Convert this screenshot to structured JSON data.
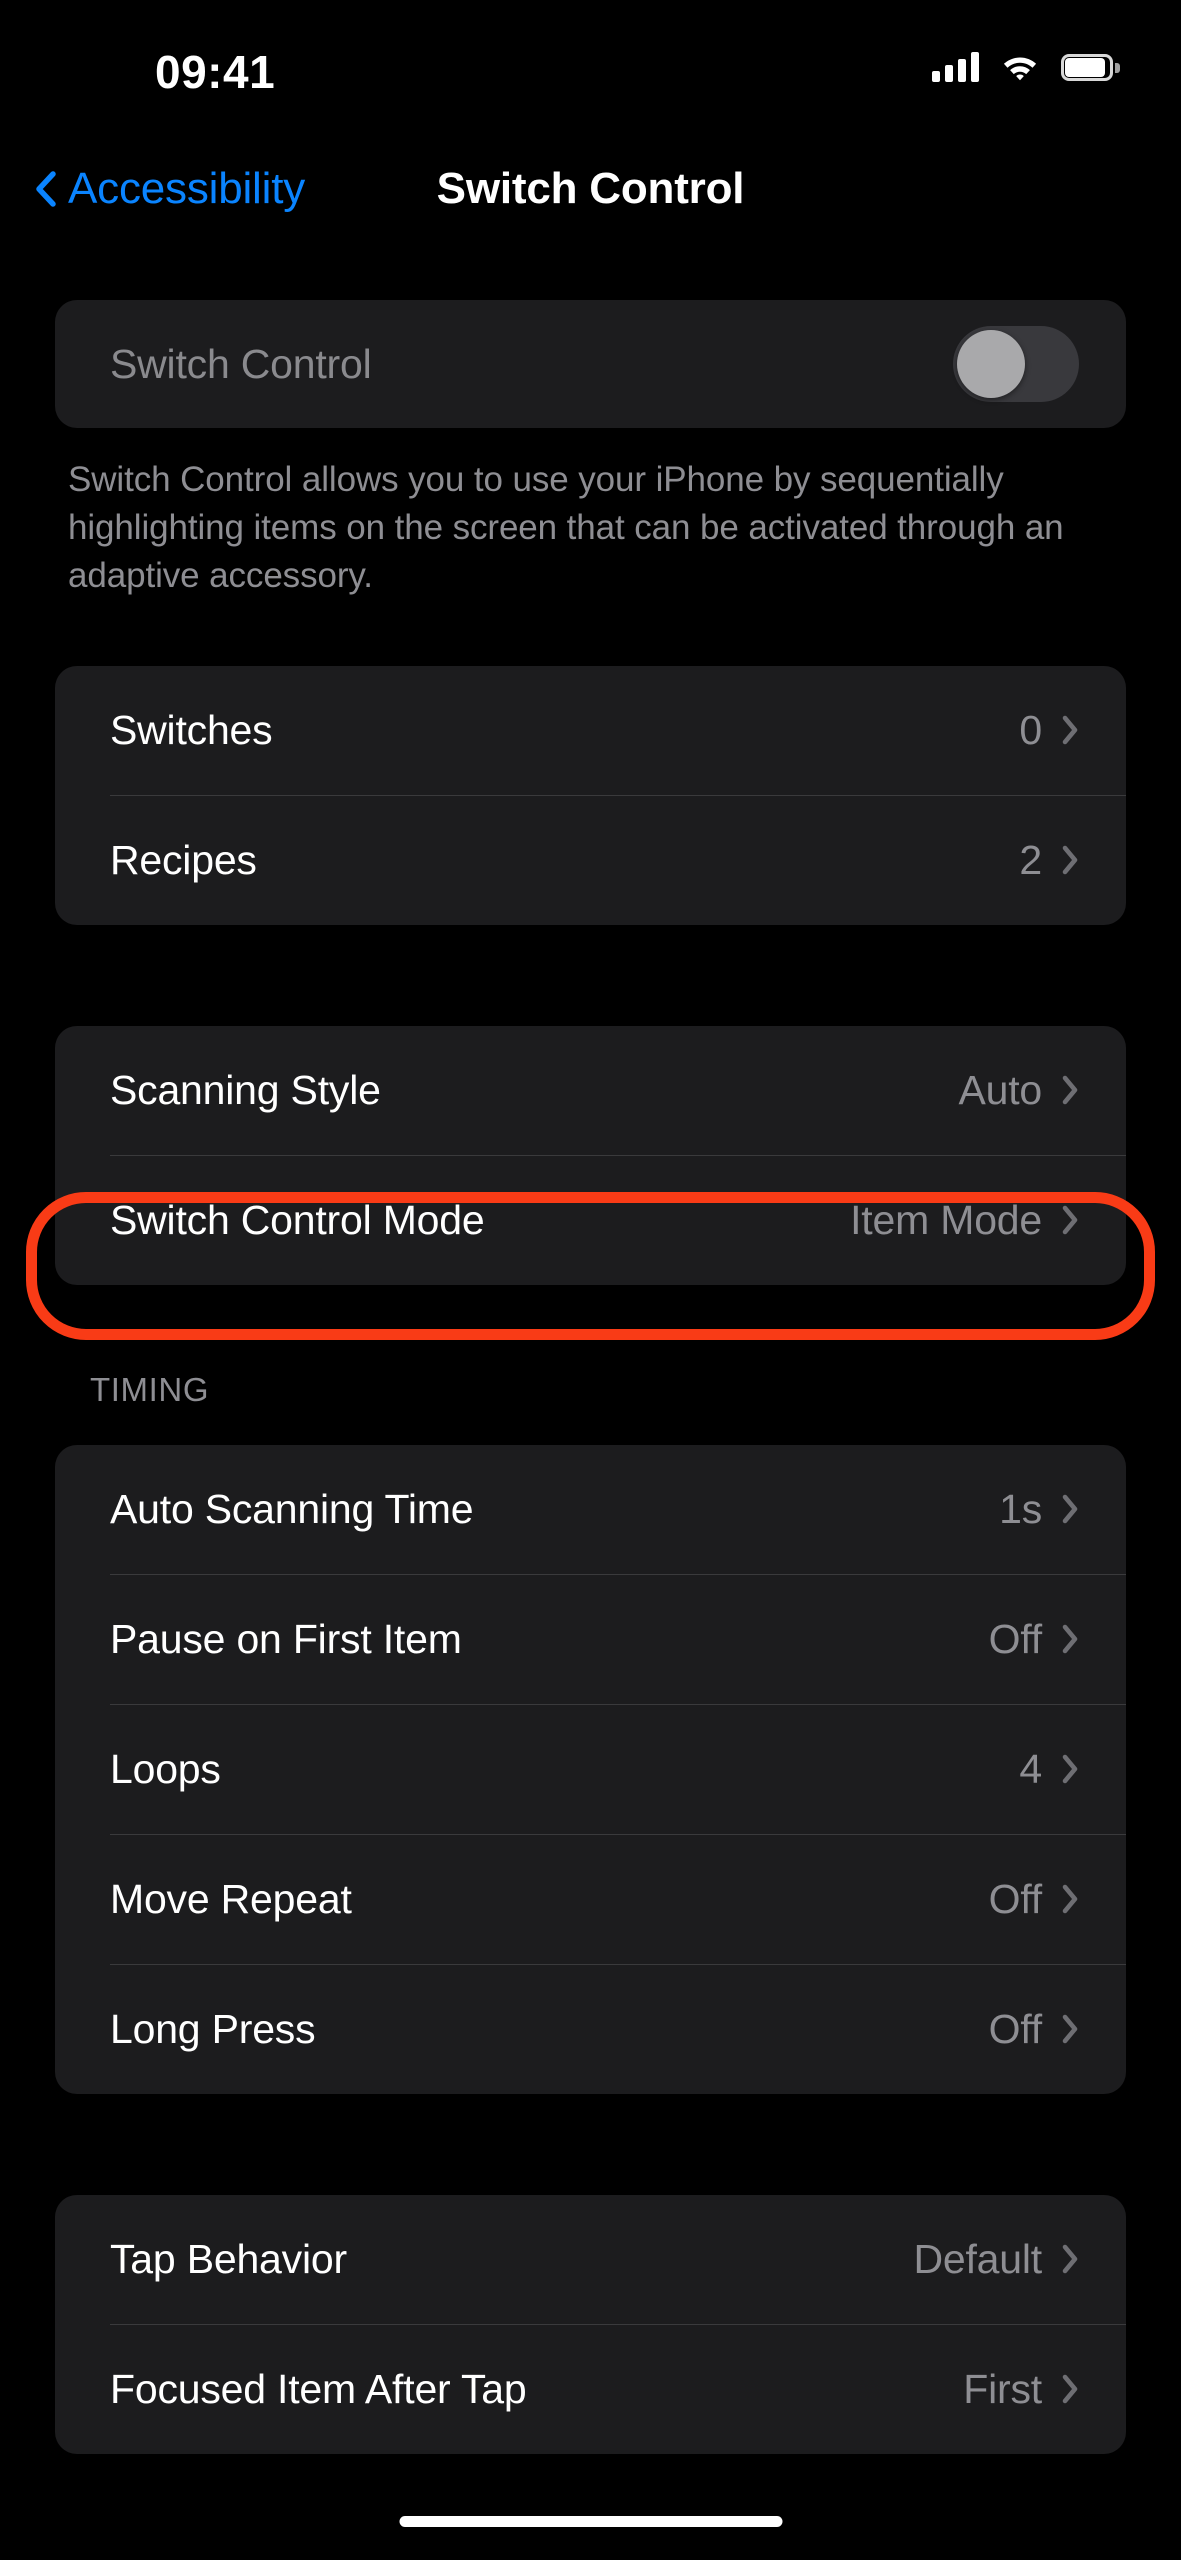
{
  "status_bar": {
    "time": "09:41",
    "cellular_icon": "cellular-signal-icon",
    "wifi_icon": "wifi-icon",
    "battery_icon": "battery-full-icon"
  },
  "nav": {
    "back_icon": "chevron-left-icon",
    "back_label": "Accessibility",
    "title": "Switch Control"
  },
  "toggle_section": {
    "label": "Switch Control",
    "state": "off",
    "footnote": "Switch Control allows you to use your iPhone by sequentially highlighting items on the screen that can be activated through an adaptive accessory."
  },
  "groups": [
    {
      "header": "",
      "rows": [
        {
          "title": "Switches",
          "value": "0",
          "chevron": "chevron-right-icon"
        },
        {
          "title": "Recipes",
          "value": "2",
          "chevron": "chevron-right-icon"
        }
      ]
    },
    {
      "header": "",
      "rows": [
        {
          "title": "Scanning Style",
          "value": "Auto",
          "chevron": "chevron-right-icon"
        },
        {
          "title": "Switch Control Mode",
          "value": "Item Mode",
          "chevron": "chevron-right-icon"
        }
      ]
    },
    {
      "header": "TIMING",
      "rows": [
        {
          "title": "Auto Scanning Time",
          "value": "1s",
          "chevron": "chevron-right-icon"
        },
        {
          "title": "Pause on First Item",
          "value": "Off",
          "chevron": "chevron-right-icon"
        },
        {
          "title": "Loops",
          "value": "4",
          "chevron": "chevron-right-icon"
        },
        {
          "title": "Move Repeat",
          "value": "Off",
          "chevron": "chevron-right-icon"
        },
        {
          "title": "Long Press",
          "value": "Off",
          "chevron": "chevron-right-icon"
        }
      ]
    },
    {
      "header": "",
      "rows": [
        {
          "title": "Tap Behavior",
          "value": "Default",
          "chevron": "chevron-right-icon"
        },
        {
          "title": "Focused Item After Tap",
          "value": "First",
          "chevron": "chevron-right-icon"
        }
      ]
    }
  ],
  "annotation": {
    "target": "Switch Control Mode",
    "color": "#f93b16",
    "shape": "rounded-rectangle-outline"
  },
  "colors": {
    "background": "#000000",
    "card": "#1c1c1e",
    "accent_blue": "#0a84ff",
    "secondary_text": "#8e8e93",
    "divider": "#3a3a3c",
    "annotation_red": "#f93b16"
  },
  "home_indicator": "home-indicator"
}
